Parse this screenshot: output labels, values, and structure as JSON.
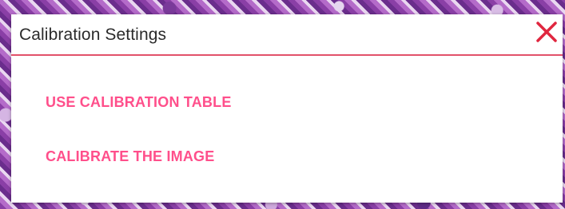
{
  "dialog": {
    "title": "Calibration Settings",
    "close_icon": "close-icon",
    "options": [
      {
        "label": "USE CALIBRATION TABLE"
      },
      {
        "label": "CALIBRATE THE IMAGE"
      }
    ]
  },
  "colors": {
    "accent": "#ff4f8b",
    "close": "#e0263f",
    "divider": "#e2516a",
    "title_text": "#2b2b2b"
  }
}
